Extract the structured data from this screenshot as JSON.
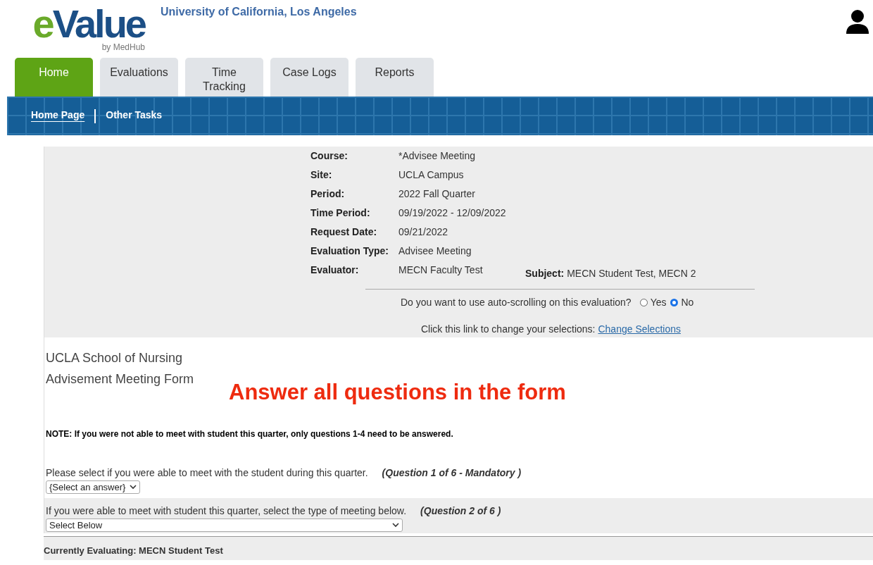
{
  "header": {
    "logo": {
      "accent": "e",
      "main": "Value",
      "tagline": "by MedHub"
    },
    "institution": "University of California, Los Angeles"
  },
  "tabs": [
    {
      "label": "Home",
      "selected": true
    },
    {
      "label": "Evaluations",
      "selected": false
    },
    {
      "label": "Time Tracking",
      "selected": false
    },
    {
      "label": "Case Logs",
      "selected": false
    },
    {
      "label": "Reports",
      "selected": false
    }
  ],
  "subnav": [
    {
      "label": "Home Page",
      "selected": true
    },
    {
      "label": "Other Tasks",
      "selected": false
    }
  ],
  "details": [
    {
      "label": "Course:",
      "value": "*Advisee Meeting"
    },
    {
      "label": "Site:",
      "value": "UCLA Campus"
    },
    {
      "label": "Period:",
      "value": "2022 Fall Quarter"
    },
    {
      "label": "Time Period:",
      "value": "09/19/2022 - 12/09/2022"
    },
    {
      "label": "Request Date:",
      "value": "09/21/2022"
    },
    {
      "label": "Evaluation Type:",
      "value": "Advisee Meeting"
    },
    {
      "label": "Evaluator:",
      "value": "MECN Faculty Test"
    }
  ],
  "subject": {
    "label": "Subject:",
    "value": "MECN Student Test, MECN 2"
  },
  "autoscroll": {
    "question": "Do you want to use auto-scrolling on this evaluation?",
    "options": [
      {
        "label": "Yes",
        "selected": false
      },
      {
        "label": "No",
        "selected": true
      }
    ]
  },
  "change_link": {
    "text": "Click this link to change your selections:",
    "link": "Change Selections"
  },
  "form": {
    "school": "UCLA School of Nursing",
    "title": "Advisement Meeting Form",
    "banner": "Answer all questions in the form",
    "note": "NOTE: If you were not able to meet with student this quarter, only questions 1-4 need to be answered."
  },
  "questions": [
    {
      "text": "Please select if you were able to meet with the student during this quarter.",
      "number": "(Question 1 of 6  - Mandatory )",
      "select": "{Select an answer}",
      "shaded": false,
      "wide": false
    },
    {
      "text": "If you were able to meet with student this quarter, select the type of meeting below.",
      "number": "(Question 2 of 6 )",
      "select": "Select Below",
      "shaded": true,
      "wide": true
    }
  ],
  "footer": "Currently Evaluating: MECN Student Test"
}
